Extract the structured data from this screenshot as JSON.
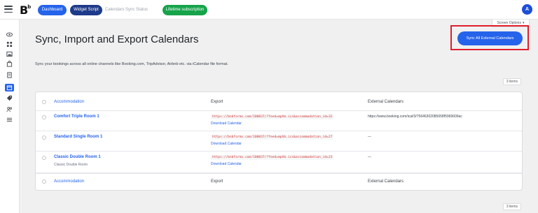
{
  "topbar": {
    "logo": "B",
    "logo_sup": "b",
    "nav": {
      "dashboard": "Dashboard",
      "widget_script": "Widget Script",
      "calendars_sync_status": "Calendars Sync Status",
      "lifetime": "Lifetime subscription"
    },
    "avatar": "A"
  },
  "sidebar": {
    "icons": [
      "eye-icon",
      "grid-icon",
      "image-icon",
      "bag-icon",
      "document-icon",
      "calendar-icon",
      "tag-icon",
      "users-icon",
      "list-icon"
    ],
    "active": "calendar-icon"
  },
  "screen_options": "Screen Options",
  "page": {
    "title": "Sync, Import and Export Calendars",
    "sync_button": "Sync All External Calendars",
    "description": "Sync your bookings across all online channels like Booking.com, TripAdvisor, Airbnb etc. via iCalendar file format.",
    "items_count": "3 items"
  },
  "table": {
    "headers": {
      "accommodation": "Accommodation",
      "export": "Export",
      "external": "External Calendars"
    },
    "rows": [
      {
        "name": "Comfort Triple Room 1",
        "subtitle": "",
        "export_url": "https://bnbforms.com/100037/?feed=mphb.ics&accommodation_id=32",
        "download": "Download Calendar",
        "external": "https://www.booking.com/ical/3/75646302085658f5969609ac"
      },
      {
        "name": "Standard Single Room 1",
        "subtitle": "",
        "export_url": "https://bnbforms.com/100037/?feed=mphb.ics&accommodation_id=27",
        "download": "Download Calendar",
        "external": "—"
      },
      {
        "name": "Classic Double Room 1",
        "subtitle": "Classic Double Room",
        "export_url": "https://bnbforms.com/100037/?feed=mphb.ics&accommodation_id=23",
        "download": "Download Calendar",
        "external": "—"
      }
    ]
  },
  "colors": {
    "primary": "#2563eb",
    "navy": "#1e3a8a",
    "green": "#16a34a",
    "highlight": "#e11d2b",
    "code_red": "#d63638"
  }
}
